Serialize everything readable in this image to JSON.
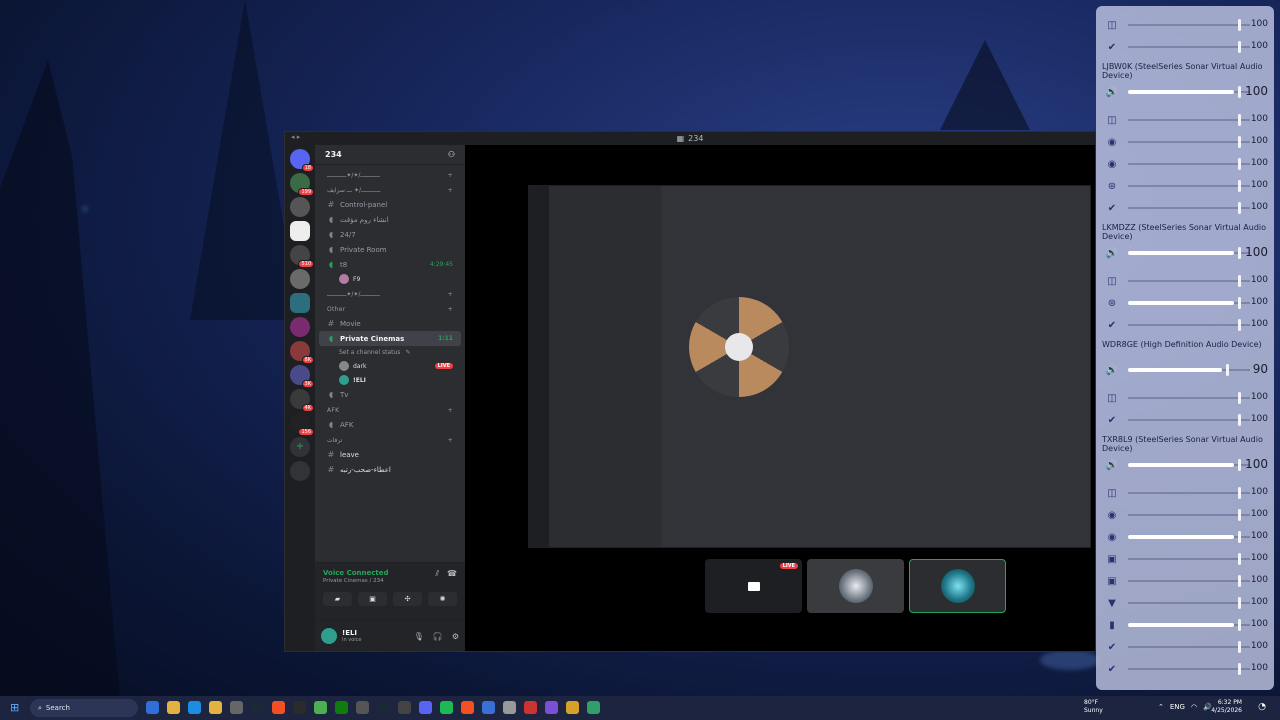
{
  "discord": {
    "window_title": "234",
    "server_name": "234",
    "categories": [
      {
        "label": "ـــــــــــ/✦/✦ـــــــــــ"
      },
      {
        "label": "ـــــــــــ/✦ ـــ سرايف"
      },
      {
        "label": "Other"
      },
      {
        "label": "ـــــــــــ/✦/✦ـــــــــــ"
      },
      {
        "label": "AFK"
      },
      {
        "label": "ترفات"
      }
    ],
    "channels": {
      "control_panel": "Control-panel",
      "arabic_1": "انشاء روم مؤقت",
      "c24": "24/7",
      "private_room": "Private Room",
      "t8": "t8",
      "t8_time": "4:29:45",
      "t8_member": "F9",
      "movie": "Movie",
      "private_cinemas": "Private Cinemas",
      "private_cinemas_time": "1:11",
      "set_status": "Set a channel status",
      "member_dark": "dark",
      "member_eli": "!ELI",
      "live": "LIVE",
      "tv": "Tv",
      "afk": "AFK",
      "leave": "leave",
      "arabic_2": "اعطاء-صحب-رتبه"
    },
    "voice": {
      "status": "Voice Connected",
      "location": "Private Cinemas / 234"
    },
    "user": {
      "name": "!ELI",
      "status": "In voice"
    },
    "tile_live": "LIVE"
  },
  "mixer": {
    "rows": [
      {
        "icon": "steelseries-icon",
        "glyph": "◫",
        "value": "100",
        "level": 1.0,
        "master": false
      },
      {
        "icon": "steam-icon",
        "glyph": "✔",
        "value": "100",
        "level": 1.0,
        "master": false
      },
      {
        "device": "LJBW0K (SteelSeries Sonar Virtual Audio Device)"
      },
      {
        "icon": "speaker-icon",
        "glyph": "🔊",
        "value": "100",
        "level": 1.0,
        "master": true
      },
      {
        "icon": "steelseries-icon",
        "glyph": "◫",
        "value": "100",
        "level": 1.0,
        "master": false
      },
      {
        "icon": "discord-icon",
        "glyph": "◉",
        "value": "100",
        "level": 1.0,
        "master": false
      },
      {
        "icon": "discord-icon",
        "glyph": "◉",
        "value": "100",
        "level": 1.0,
        "master": false
      },
      {
        "icon": "obs-icon",
        "glyph": "⊛",
        "value": "100",
        "level": 1.0,
        "master": false
      },
      {
        "icon": "steam-icon",
        "glyph": "✔",
        "value": "100",
        "level": 1.0,
        "master": false
      },
      {
        "device": "LKMDZZ (SteelSeries Sonar Virtual Audio Device)"
      },
      {
        "icon": "speaker-icon",
        "glyph": "🔊",
        "value": "100",
        "level": 1.0,
        "master": true
      },
      {
        "icon": "steelseries-icon",
        "glyph": "◫",
        "value": "100",
        "level": 1.0,
        "master": false
      },
      {
        "icon": "obs-icon",
        "glyph": "⊛",
        "value": "100",
        "level": 1.0,
        "master": false
      },
      {
        "icon": "steam-icon",
        "glyph": "✔",
        "value": "100",
        "level": 1.0,
        "master": false
      },
      {
        "device": "WDR8GE (High Definition Audio Device)"
      },
      {
        "icon": "speaker-icon",
        "glyph": "🔊",
        "value": "90",
        "level": 0.9,
        "master": true
      },
      {
        "icon": "steelseries-icon",
        "glyph": "◫",
        "value": "100",
        "level": 1.0,
        "master": false
      },
      {
        "icon": "steam-icon",
        "glyph": "✔",
        "value": "100",
        "level": 1.0,
        "master": false
      },
      {
        "device": "TXR8L9 (SteelSeries Sonar Virtual Audio Device)"
      },
      {
        "icon": "speaker-icon",
        "glyph": "🔊",
        "value": "100",
        "level": 1.0,
        "master": true
      },
      {
        "icon": "steelseries-icon",
        "glyph": "◫",
        "value": "100",
        "level": 1.0,
        "master": false
      },
      {
        "icon": "discord-icon",
        "glyph": "◉",
        "value": "100",
        "level": 1.0,
        "master": false
      },
      {
        "icon": "discord-icon",
        "glyph": "◉",
        "value": "100",
        "level": 1.0,
        "master": false
      },
      {
        "icon": "app-icon",
        "glyph": "▣",
        "value": "100",
        "level": 1.0,
        "master": false
      },
      {
        "icon": "app-icon",
        "glyph": "▣",
        "value": "100",
        "level": 1.0,
        "master": false
      },
      {
        "icon": "brave-icon",
        "glyph": "▼",
        "value": "100",
        "level": 1.0,
        "master": false
      },
      {
        "icon": "app-icon",
        "glyph": "▮",
        "value": "100",
        "level": 1.0,
        "master": false
      },
      {
        "icon": "steam-icon",
        "glyph": "✔",
        "value": "100",
        "level": 1.0,
        "master": false
      },
      {
        "icon": "steam-icon",
        "glyph": "✔",
        "value": "100",
        "level": 1.0,
        "master": false
      }
    ]
  },
  "taskbar": {
    "search_placeholder": "Search",
    "weather_temp": "80°F",
    "weather_desc": "Sunny",
    "lang": "ENG",
    "time": "6:32 PM",
    "date": "4/25/2026",
    "apps": [
      "windows-icon",
      "file-explorer-icon",
      "edge-icon",
      "folder-icon",
      "settings-icon",
      "steam-icon",
      "brave-icon",
      "epic-icon",
      "minecraft-icon",
      "xbox-icon",
      "app-icon",
      "steam-icon",
      "app-icon",
      "discord-icon",
      "spotify-icon",
      "brave-icon",
      "app-icon",
      "app-icon",
      "app-icon",
      "app-icon",
      "app-icon",
      "app-icon"
    ]
  }
}
